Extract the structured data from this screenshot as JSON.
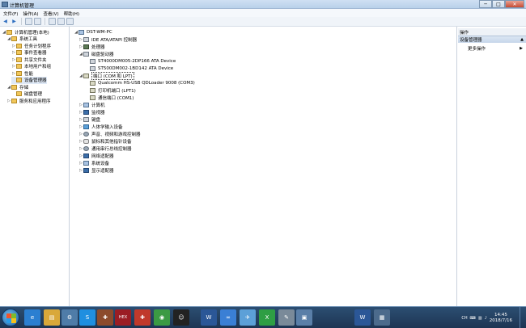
{
  "window": {
    "title": "计算机管理"
  },
  "title_buttons": {
    "min": "─",
    "max": "□",
    "close": "✕"
  },
  "menu": [
    "文件(F)",
    "操作(A)",
    "查看(V)",
    "帮助(H)"
  ],
  "left_tree": [
    {
      "label": "计算机管理(本地)",
      "icon": "computer-icon",
      "arrow": "◢",
      "selected": false
    },
    {
      "label": "系统工具",
      "icon": "tools-icon",
      "arrow": "◢",
      "selected": false
    },
    {
      "label": "任务计划程序",
      "icon": "clock-icon",
      "arrow": "▷",
      "selected": false
    },
    {
      "label": "事件查看器",
      "icon": "event-icon",
      "arrow": "▷",
      "selected": false
    },
    {
      "label": "共享文件夹",
      "icon": "folder-icon",
      "arrow": "▷",
      "selected": false
    },
    {
      "label": "本地用户和组",
      "icon": "users-icon",
      "arrow": "▷",
      "selected": false
    },
    {
      "label": "性能",
      "icon": "performance-icon",
      "arrow": "▷",
      "selected": false
    },
    {
      "label": "设备管理器",
      "icon": "device-manager-icon",
      "arrow": "",
      "selected": true
    },
    {
      "label": "存储",
      "icon": "storage-icon",
      "arrow": "◢",
      "selected": false
    },
    {
      "label": "磁盘管理",
      "icon": "disk-icon",
      "arrow": "",
      "selected": false
    },
    {
      "label": "服务和应用程序",
      "icon": "services-icon",
      "arrow": "▷",
      "selected": false
    }
  ],
  "device_tree": [
    {
      "label": "DST-WM-PC",
      "icon": "computer-icon",
      "arrow": "◢"
    },
    {
      "label": "IDE ATA/ATAPI 控制器",
      "icon": "ide-icon",
      "arrow": "▷"
    },
    {
      "label": "处理器",
      "icon": "processor-icon",
      "arrow": "▷"
    },
    {
      "label": "磁盘驱动器",
      "icon": "disk-drive-icon",
      "arrow": "◢"
    },
    {
      "label": "ST4000DM005-2DP166 ATA Device",
      "icon": "disk-icon",
      "arrow": ""
    },
    {
      "label": "ST500DM002-1BD142 ATA Device",
      "icon": "disk-icon",
      "arrow": ""
    },
    {
      "label": "端口 (COM 和 LPT)",
      "icon": "port-icon",
      "arrow": "◢"
    },
    {
      "label": "Qualcomm HS-USB QDLoader 9008 (COM3)",
      "icon": "port-icon",
      "arrow": ""
    },
    {
      "label": "打印机端口 (LPT1)",
      "icon": "port-icon",
      "arrow": ""
    },
    {
      "label": "通信端口 (COM1)",
      "icon": "port-icon",
      "arrow": ""
    },
    {
      "label": "计算机",
      "icon": "computer-icon",
      "arrow": "▷"
    },
    {
      "label": "监视器",
      "icon": "monitor-icon",
      "arrow": "▷"
    },
    {
      "label": "键盘",
      "icon": "keyboard-icon",
      "arrow": "▷"
    },
    {
      "label": "人体学输入设备",
      "icon": "hid-icon",
      "arrow": "▷"
    },
    {
      "label": "声音、视频和游戏控制器",
      "icon": "sound-icon",
      "arrow": "▷"
    },
    {
      "label": "鼠标和其他指针设备",
      "icon": "mouse-icon",
      "arrow": "▷"
    },
    {
      "label": "通用串行总线控制器",
      "icon": "usb-icon",
      "arrow": "▷"
    },
    {
      "label": "网络适配器",
      "icon": "network-icon",
      "arrow": "▷"
    },
    {
      "label": "系统设备",
      "icon": "system-device-icon",
      "arrow": "▷"
    },
    {
      "label": "显示适配器",
      "icon": "display-adapter-icon",
      "arrow": "▷"
    }
  ],
  "actions": {
    "header": "操作",
    "section": "设备管理器",
    "more": "更多操作",
    "section_arrow": "▲",
    "more_arrow": "▶"
  },
  "taskbar": {
    "icons": [
      {
        "name": "ie-icon",
        "glyph": "e",
        "color": "#2b7fd1"
      },
      {
        "name": "explorer-icon",
        "glyph": "▤",
        "color": "#d9a83a"
      },
      {
        "name": "control-panel-icon",
        "glyph": "⚙",
        "color": "#4f7ca8"
      },
      {
        "name": "app-s-icon",
        "glyph": "S",
        "color": "#1f8fe0"
      },
      {
        "name": "tool-icon",
        "glyph": "✚",
        "color": "#8c4b2c"
      },
      {
        "name": "hex-icon",
        "glyph": "HEX",
        "color": "#9b1d24"
      },
      {
        "name": "medical-icon",
        "glyph": "✚",
        "color": "#c0392b"
      },
      {
        "name": "chrome-icon",
        "glyph": "◉",
        "color": "#3b9a43"
      },
      {
        "name": "qq-icon",
        "glyph": "☺",
        "color": "#222222"
      },
      {
        "name": "word-icon",
        "glyph": "W",
        "color": "#2b5797"
      },
      {
        "name": "baidu-icon",
        "glyph": "∞",
        "color": "#3a7fd5"
      },
      {
        "name": "bird-icon",
        "glyph": "✈",
        "color": "#5ca0d8"
      },
      {
        "name": "xshell-icon",
        "glyph": "X",
        "color": "#2e9e44"
      },
      {
        "name": "paint-icon",
        "glyph": "✎",
        "color": "#7a8a99"
      },
      {
        "name": "device-icon",
        "glyph": "▣",
        "color": "#5a7fa8"
      },
      {
        "name": "word2-icon",
        "glyph": "W",
        "color": "#2b5797"
      },
      {
        "name": "computer-mgmt-icon",
        "glyph": "▦",
        "color": "#4c6b8c"
      }
    ],
    "tray_lang": "CH",
    "time": "14:45",
    "date": "2018/7/16"
  }
}
